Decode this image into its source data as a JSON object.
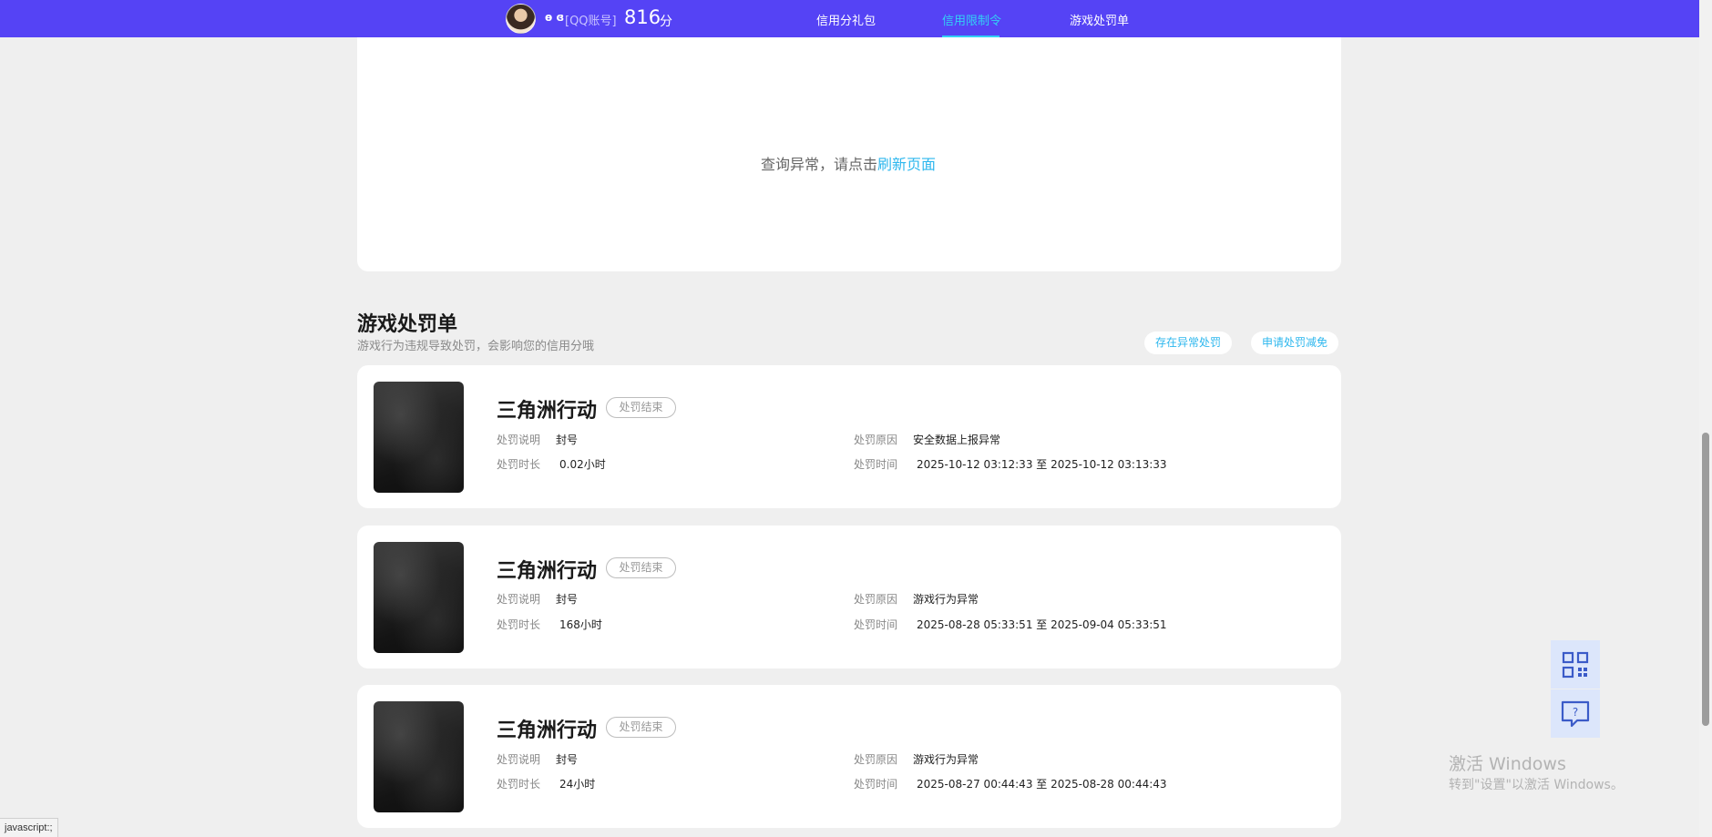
{
  "header": {
    "nickname": "ɵ ɞ",
    "account_tag": "[QQ账号]",
    "score": "816",
    "score_unit": "分",
    "nav": [
      {
        "label": "信用分礼包",
        "active": false
      },
      {
        "label": "信用限制令",
        "active": true
      },
      {
        "label": "游戏处罚单",
        "active": false
      }
    ]
  },
  "error_panel": {
    "message": "查询异常，请点击",
    "link": "刷新页面"
  },
  "section": {
    "title": "游戏处罚单",
    "subtitle": "游戏行为违规导致处罚，会影响您的信用分哦",
    "btn_abnormal": "存在异常处罚",
    "btn_appeal": "申请处罚减免"
  },
  "labels": {
    "desc": "处罚说明",
    "duration": "处罚时长",
    "reason": "处罚原因",
    "time": "处罚时间"
  },
  "cards": [
    {
      "game": "三角洲行动",
      "status": "处罚结束",
      "desc": "封号",
      "duration": "0.02小时",
      "reason": "安全数据上报异常",
      "time": "2025-10-12 03:12:33 至 2025-10-12 03:13:33"
    },
    {
      "game": "三角洲行动",
      "status": "处罚结束",
      "desc": "封号",
      "duration": "168小时",
      "reason": "游戏行为异常",
      "time": "2025-08-28 05:33:51 至 2025-09-04 05:33:51"
    },
    {
      "game": "三角洲行动",
      "status": "处罚结束",
      "desc": "封号",
      "duration": "24小时",
      "reason": "游戏行为异常",
      "time": "2025-08-27 00:44:43 至 2025-08-28 00:44:43"
    }
  ],
  "floating": {
    "icons": [
      "qrcode-icon",
      "feedback-icon"
    ],
    "feedback_glyph": "?"
  },
  "watermark": {
    "line1": "激活 Windows",
    "line2": "转到\"设置\"以激活 Windows。"
  },
  "statusbar": "javascript:;",
  "colors": {
    "nav_bg": "#5543f5",
    "accent": "#33d0f5",
    "link": "#2db7ee",
    "page_bg": "#efefef"
  }
}
